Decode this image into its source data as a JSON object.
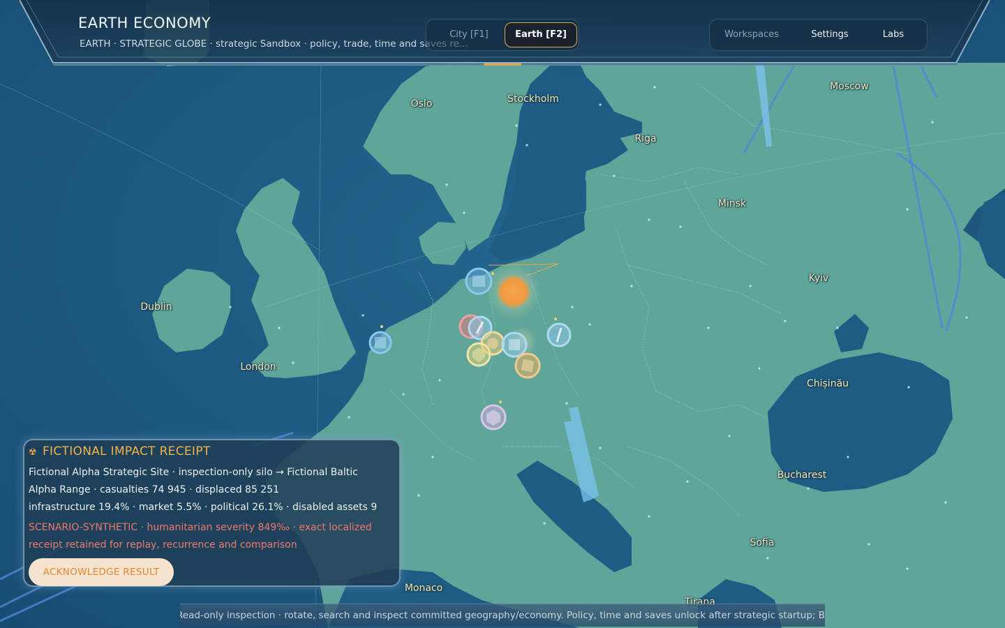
{
  "app": {
    "title": "EARTH ECONOMY",
    "subtitle": "EARTH · STRATEGIC GLOBE · strategic Sandbox · policy, trade, time and saves re..."
  },
  "modes": {
    "city": "City  [F1]",
    "earth": "Earth  [F2]",
    "active": "earth"
  },
  "nav": {
    "workspaces": "Workspaces",
    "settings": "Settings",
    "labs": "Labs"
  },
  "cities": [
    {
      "name": "Oslo"
    },
    {
      "name": "Stockholm"
    },
    {
      "name": "Moscow"
    },
    {
      "name": "Riga"
    },
    {
      "name": "Minsk"
    },
    {
      "name": "Kyiv"
    },
    {
      "name": "Dublin"
    },
    {
      "name": "London"
    },
    {
      "name": "Chișinău"
    },
    {
      "name": "Bucharest"
    },
    {
      "name": "Sofia"
    },
    {
      "name": "Monaco"
    },
    {
      "name": "Tirana"
    }
  ],
  "receipt": {
    "title": "FICTIONAL IMPACT RECEIPT",
    "icon": "radiation-icon",
    "line1": "Fictional Alpha Strategic Site · inspection-only silo → Fictional Baltic",
    "line2": "Alpha Range  ·  casualties 74 945  ·  displaced 85 251",
    "line3": "infrastructure 19.4%  ·  market 5.5%  ·  political 26.1%  ·  disabled assets 9",
    "warn1": "SCENARIO-SYNTHETIC · humanitarian severity 849‰ · exact localized",
    "warn2": "receipt retained for replay, recurrence and comparison",
    "ack_label": "ACKNOWLEDGE RESULT"
  },
  "status": "Read-only inspection · rotate, search and inspect committed geography/economy. Policy, time and saves unlock after strategic startup; B...",
  "colors": {
    "ocean": "#1d5a82",
    "land": "#5fa59a",
    "accent": "#e0a848",
    "warn": "#ef7a6c",
    "impact": "#f0a040"
  }
}
